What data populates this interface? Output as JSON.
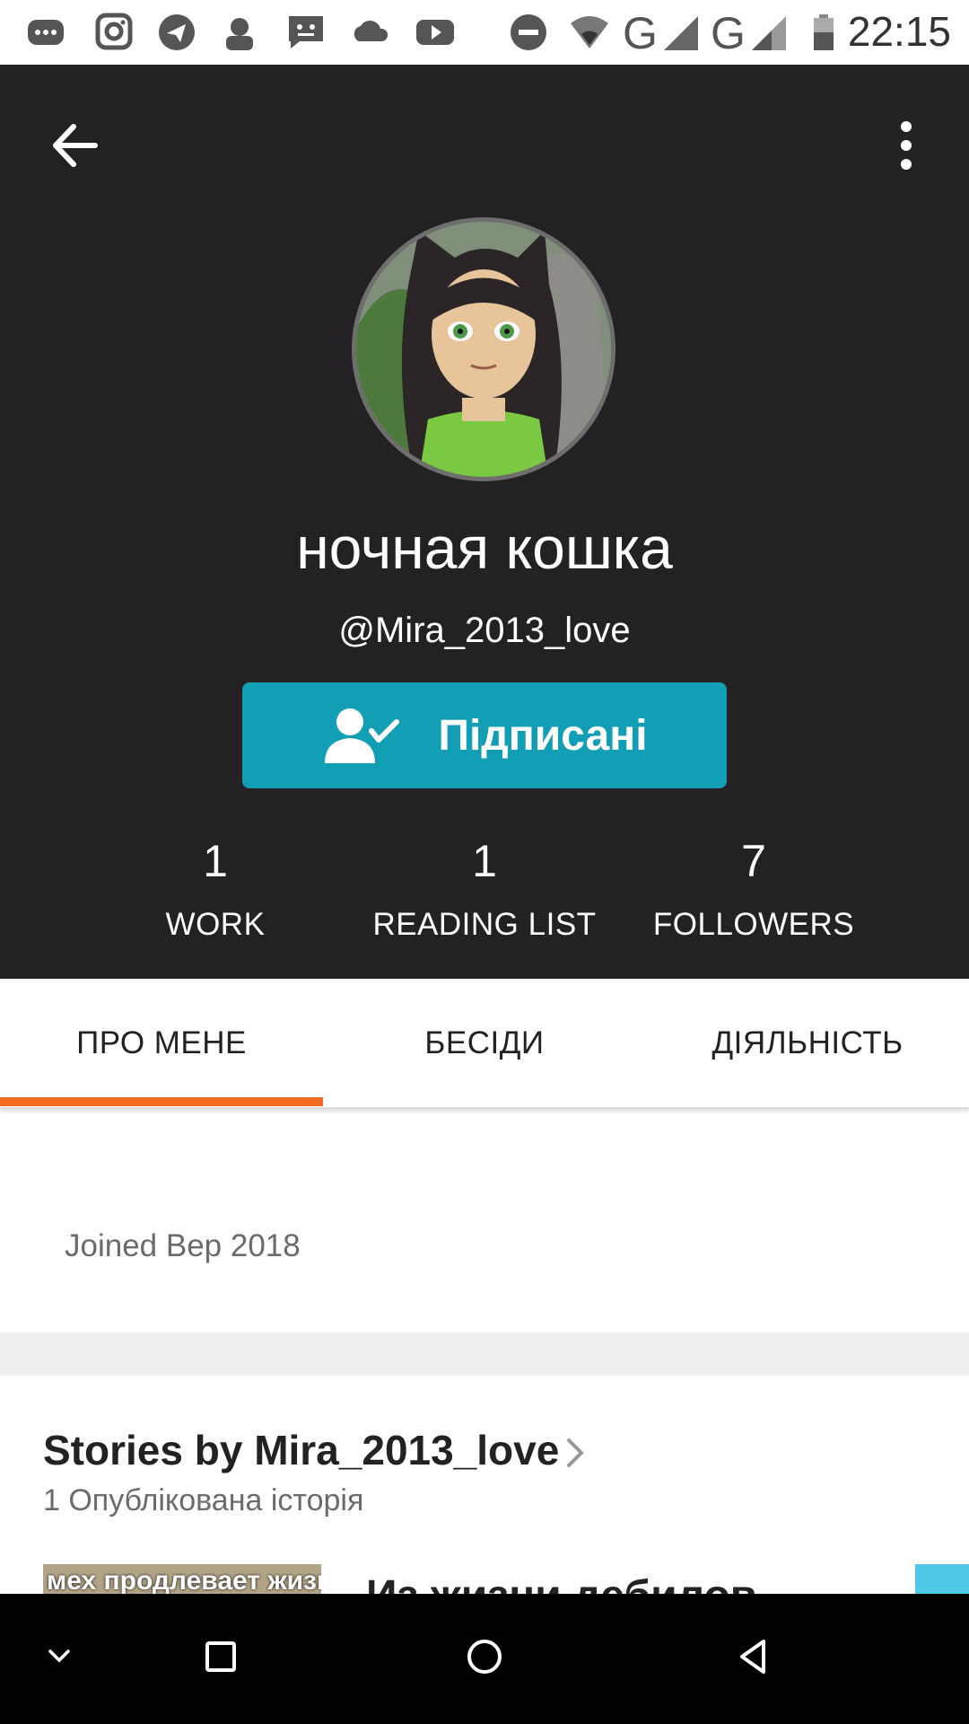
{
  "status_bar": {
    "time": "22:15",
    "icons": [
      "chat-bubble-icon",
      "instagram-icon",
      "telegram-icon",
      "app-icon",
      "message-icon",
      "cloud-icon",
      "youtube-icon",
      "do-not-disturb-icon",
      "wifi-icon",
      "signal-icon",
      "signal-icon",
      "battery-icon"
    ],
    "network_1": "G",
    "network_2": "G"
  },
  "header": {
    "back_icon": "arrow-left-icon",
    "more_icon": "more-vertical-icon",
    "display_name": "ночная кошка",
    "username": "@Mira_2013_love",
    "follow_button": {
      "label": "Підписані",
      "icon": "user-check-icon",
      "color": "#129fb5"
    },
    "stats": [
      {
        "value": "1",
        "label": "WORK"
      },
      {
        "value": "1",
        "label": "READING LIST"
      },
      {
        "value": "7",
        "label": "FOLLOWERS"
      }
    ],
    "background": "#232124"
  },
  "tabs": {
    "items": [
      "ПРО МЕНЕ",
      "БЕСІДИ",
      "ДІЯЛЬНІСТЬ"
    ],
    "active": "ПРО МЕНЕ",
    "indicator_color": "#f36a21"
  },
  "about": {
    "joined": "Joined Вер 2018"
  },
  "stories": {
    "title": "Stories by Mira_2013_love",
    "count": "1 Опублікована історія",
    "first_story": {
      "cover_text": "мех продлевает жизнь",
      "title": "Из жизни дебилов"
    }
  },
  "nav_bar": {
    "icons": [
      "chevron-down-icon",
      "square-icon",
      "circle-icon",
      "triangle-back-icon"
    ]
  }
}
